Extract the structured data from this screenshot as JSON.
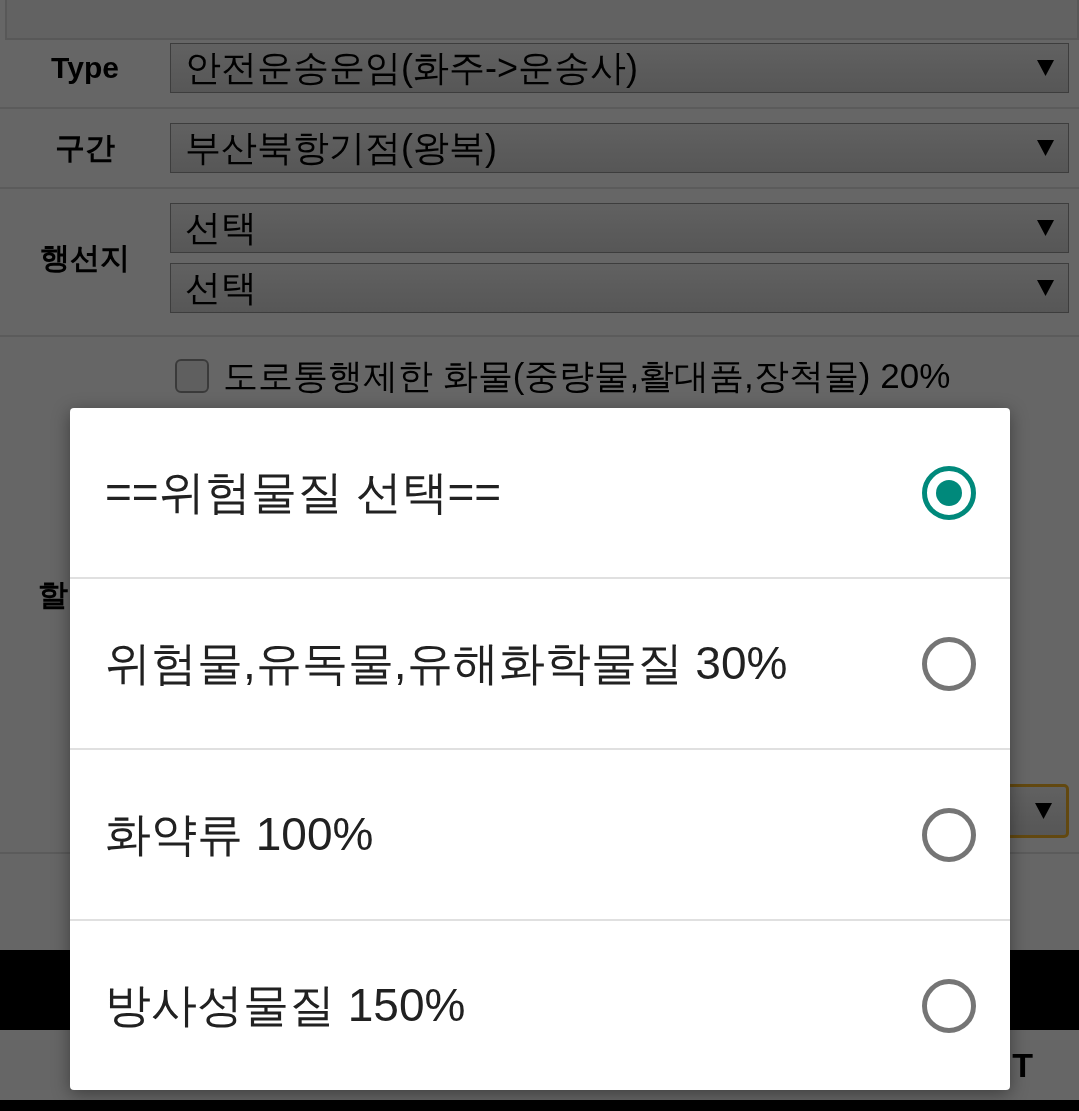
{
  "form": {
    "rows": [
      {
        "kind": "select",
        "label": "Type",
        "selects": [
          {
            "value": "안전운송운임(화주->운송사)"
          }
        ]
      },
      {
        "kind": "select",
        "label": "구간",
        "selects": [
          {
            "value": "부산북항기점(왕복)"
          }
        ]
      },
      {
        "kind": "select",
        "label": "행선지",
        "selects": [
          {
            "value": "선택"
          },
          {
            "value": "선택"
          }
        ]
      },
      {
        "kind": "options",
        "label": "할",
        "checkboxes": [
          {
            "label": "도로통행제한 화물(중량물,활대품,장척물) 20%",
            "checked": false
          }
        ],
        "selects": [
          {
            "focused": true
          }
        ]
      }
    ]
  },
  "bottom_bar": {
    "button_text": "T"
  },
  "dialog": {
    "options": [
      {
        "label": "==위험물질 선택==",
        "selected": true
      },
      {
        "label": "위험물,유독물,유해화학물질 30%",
        "selected": false
      },
      {
        "label": "화약류 100%",
        "selected": false
      },
      {
        "label": "방사성물질 150%",
        "selected": false
      }
    ]
  }
}
